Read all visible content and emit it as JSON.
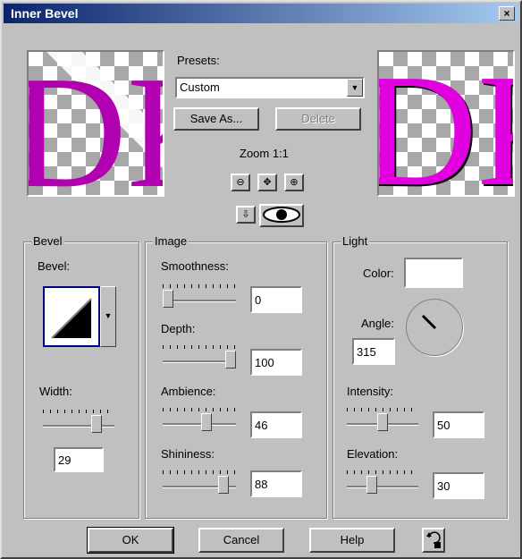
{
  "window": {
    "title": "Inner Bevel",
    "close_label": "×"
  },
  "presets": {
    "label": "Presets:",
    "value": "Custom",
    "save_as": "Save As...",
    "delete": "Delete"
  },
  "zoom": {
    "label": "Zoom 1:1"
  },
  "preview": {
    "glyphs": "DK",
    "glyph_color": "#cc00cc"
  },
  "bevel_group": {
    "title": "Bevel",
    "bevel_label": "Bevel:",
    "width_label": "Width:",
    "width_value": "29",
    "width_level": 0.8
  },
  "image_group": {
    "title": "Image",
    "smoothness": {
      "label": "Smoothness:",
      "value": "0",
      "level": 0.0
    },
    "depth": {
      "label": "Depth:",
      "value": "100",
      "level": 1.0
    },
    "ambience": {
      "label": "Ambience:",
      "value": "46",
      "level": 0.62
    },
    "shininess": {
      "label": "Shininess:",
      "value": "88",
      "level": 0.88
    }
  },
  "light_group": {
    "title": "Light",
    "color_label": "Color:",
    "color_value": "#ffffff",
    "angle_label": "Angle:",
    "angle_value": "315",
    "intensity": {
      "label": "Intensity:",
      "value": "50",
      "level": 0.5
    },
    "elevation": {
      "label": "Elevation:",
      "value": "30",
      "level": 0.33
    }
  },
  "buttons": {
    "ok": "OK",
    "cancel": "Cancel",
    "help": "Help"
  },
  "icons": [
    "close-icon",
    "zoom-out-icon",
    "pan-icon",
    "zoom-in-icon",
    "proof-icon",
    "eye-icon",
    "reset-icon",
    "dropdown-arrow-icon"
  ]
}
